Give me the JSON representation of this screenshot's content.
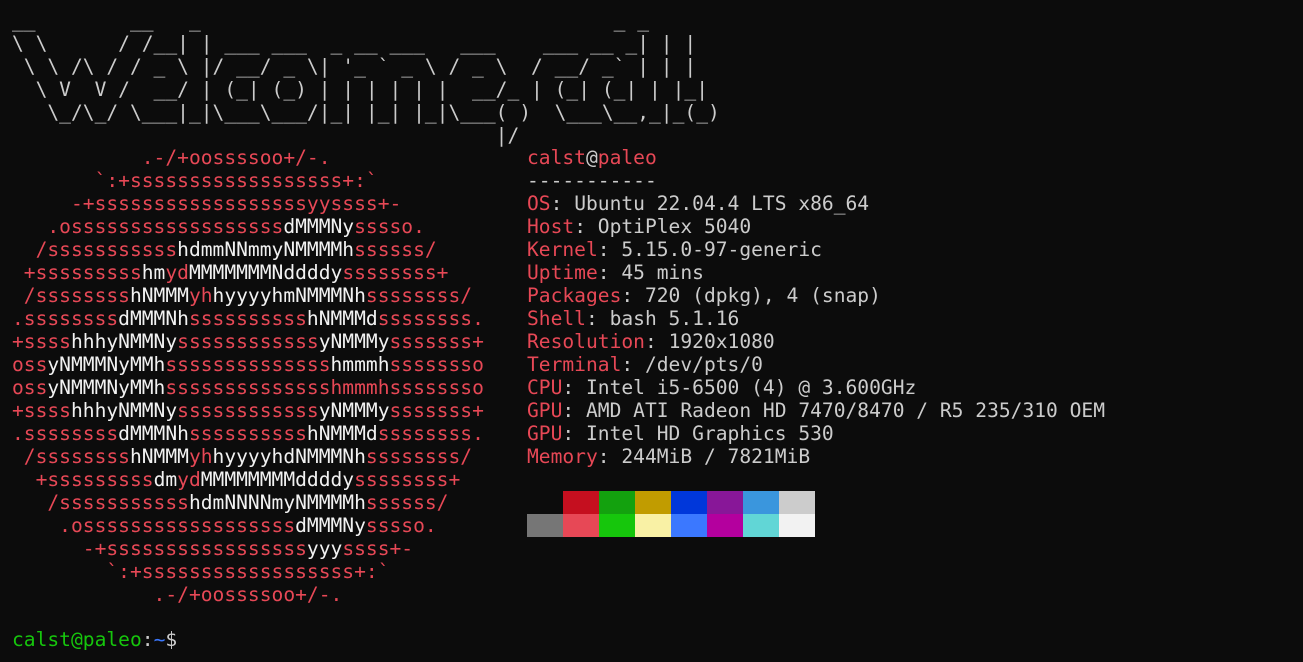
{
  "banner": {
    "ascii": "__        __   _                                   _ _ \n\\ \\      / /__| | ___ ___  _ __ ___   ___    ___ __ _| | |\n \\ \\ /\\ / / _ \\ |/ __/ _ \\| '_ ` _ \\ / _ \\  / __/ _` | | |\n  \\ V  V /  __/ | (_| (_) | | | | | |  __/_ | (_| (_| | |_|\n   \\_/\\_/ \\___|_|\\___\\___/|_| |_| |_|\\___( )  \\___\\__,_|_(_)\n                                         |/               "
  },
  "logo": {
    "lines": [
      [
        [
          "r",
          "           .-/+oossssoo+/-."
        ]
      ],
      [
        [
          "r",
          "       `:+ssssssssssssssssss+:`"
        ]
      ],
      [
        [
          "r",
          "     -+ssssssssssssssssssyyssss+-"
        ]
      ],
      [
        [
          "r",
          "   .ossssssssssssssssss"
        ],
        [
          "w",
          "dMMMNy"
        ],
        [
          "r",
          "sssso."
        ]
      ],
      [
        [
          "r",
          "  /sssssssssss"
        ],
        [
          "w",
          "hdmmNNmmyNMMMMh"
        ],
        [
          "r",
          "ssssss/"
        ]
      ],
      [
        [
          "r",
          " +sssssssss"
        ],
        [
          "w",
          "hm"
        ],
        [
          "r",
          "yd"
        ],
        [
          "w",
          "MMMMMMMNddddy"
        ],
        [
          "r",
          "ssssssss+"
        ]
      ],
      [
        [
          "r",
          " /ssssssss"
        ],
        [
          "w",
          "hNMMM"
        ],
        [
          "r",
          "yh"
        ],
        [
          "w",
          "hyyyyhmNMMMNh"
        ],
        [
          "r",
          "ssssssss/"
        ]
      ],
      [
        [
          "r",
          ".ssssssss"
        ],
        [
          "w",
          "dMMMNh"
        ],
        [
          "r",
          "ssssssssss"
        ],
        [
          "w",
          "hNMMMd"
        ],
        [
          "r",
          "ssssssss."
        ]
      ],
      [
        [
          "r",
          "+ssss"
        ],
        [
          "w",
          "hhhyNMMNy"
        ],
        [
          "r",
          "ssssssssssss"
        ],
        [
          "w",
          "yNMMMy"
        ],
        [
          "r",
          "sssssss+"
        ]
      ],
      [
        [
          "r",
          "oss"
        ],
        [
          "w",
          "yNMMMNyMMh"
        ],
        [
          "r",
          "ssssssssssssss"
        ],
        [
          "w",
          "hmmmh"
        ],
        [
          "r",
          "ssssssso"
        ]
      ],
      [
        [
          "r",
          "oss"
        ],
        [
          "w",
          "yNMMMNyMMh"
        ],
        [
          "r",
          "sssssssssssssshmmmhssssssso"
        ]
      ],
      [
        [
          "r",
          "+ssss"
        ],
        [
          "w",
          "hhhyNMMNy"
        ],
        [
          "r",
          "ssssssssssss"
        ],
        [
          "w",
          "yNMMMy"
        ],
        [
          "r",
          "sssssss+"
        ]
      ],
      [
        [
          "r",
          ".ssssssss"
        ],
        [
          "w",
          "dMMMNh"
        ],
        [
          "r",
          "ssssssssss"
        ],
        [
          "w",
          "hNMMMd"
        ],
        [
          "r",
          "ssssssss."
        ]
      ],
      [
        [
          "r",
          " /ssssssss"
        ],
        [
          "w",
          "hNMMM"
        ],
        [
          "r",
          "yh"
        ],
        [
          "w",
          "hyyyyhdNMMMNh"
        ],
        [
          "r",
          "ssssssss/"
        ]
      ],
      [
        [
          "r",
          "  +sssssssss"
        ],
        [
          "w",
          "dm"
        ],
        [
          "r",
          "yd"
        ],
        [
          "w",
          "MMMMMMMMddddy"
        ],
        [
          "r",
          "ssssssss+"
        ]
      ],
      [
        [
          "r",
          "   /sssssssssss"
        ],
        [
          "w",
          "hdmNNNNmyNMMMMh"
        ],
        [
          "r",
          "ssssss/"
        ]
      ],
      [
        [
          "r",
          "    .ossssssssssssssssss"
        ],
        [
          "w",
          "dMMMNy"
        ],
        [
          "r",
          "sssso."
        ]
      ],
      [
        [
          "r",
          "      -+sssssssssssssssss"
        ],
        [
          "w",
          "yyy"
        ],
        [
          "r",
          "ssss+-"
        ]
      ],
      [
        [
          "r",
          "        `:+ssssssssssssssssss+:`"
        ]
      ],
      [
        [
          "r",
          "            .-/+oossssoo+/-."
        ]
      ]
    ]
  },
  "info": {
    "user": "calst",
    "at": "@",
    "host": "paleo",
    "divider": "-----------",
    "fields": [
      {
        "key": "OS",
        "value": "Ubuntu 22.04.4 LTS x86_64"
      },
      {
        "key": "Host",
        "value": "OptiPlex 5040"
      },
      {
        "key": "Kernel",
        "value": "5.15.0-97-generic"
      },
      {
        "key": "Uptime",
        "value": "45 mins"
      },
      {
        "key": "Packages",
        "value": "720 (dpkg), 4 (snap)"
      },
      {
        "key": "Shell",
        "value": "bash 5.1.16"
      },
      {
        "key": "Resolution",
        "value": "1920x1080"
      },
      {
        "key": "Terminal",
        "value": "/dev/pts/0"
      },
      {
        "key": "CPU",
        "value": "Intel i5-6500 (4) @ 3.600GHz"
      },
      {
        "key": "GPU",
        "value": "AMD ATI Radeon HD 7470/8470 / R5 235/310 OEM"
      },
      {
        "key": "GPU",
        "value": "Intel HD Graphics 530"
      },
      {
        "key": "Memory",
        "value": "244MiB / 7821MiB"
      }
    ]
  },
  "palette": {
    "row1": [
      "#0c0c0c",
      "#c50f1f",
      "#13a10e",
      "#c19c00",
      "#0037da",
      "#881798",
      "#3a96dd",
      "#cccccc"
    ],
    "row2": [
      "#767676",
      "#e74856",
      "#16c60c",
      "#f9f1a5",
      "#3b78ff",
      "#b4009e",
      "#61d6d6",
      "#f2f2f2"
    ]
  },
  "prompt": {
    "user_host": "calst@paleo",
    "colon": ":",
    "path": "~",
    "symbol": "$"
  }
}
